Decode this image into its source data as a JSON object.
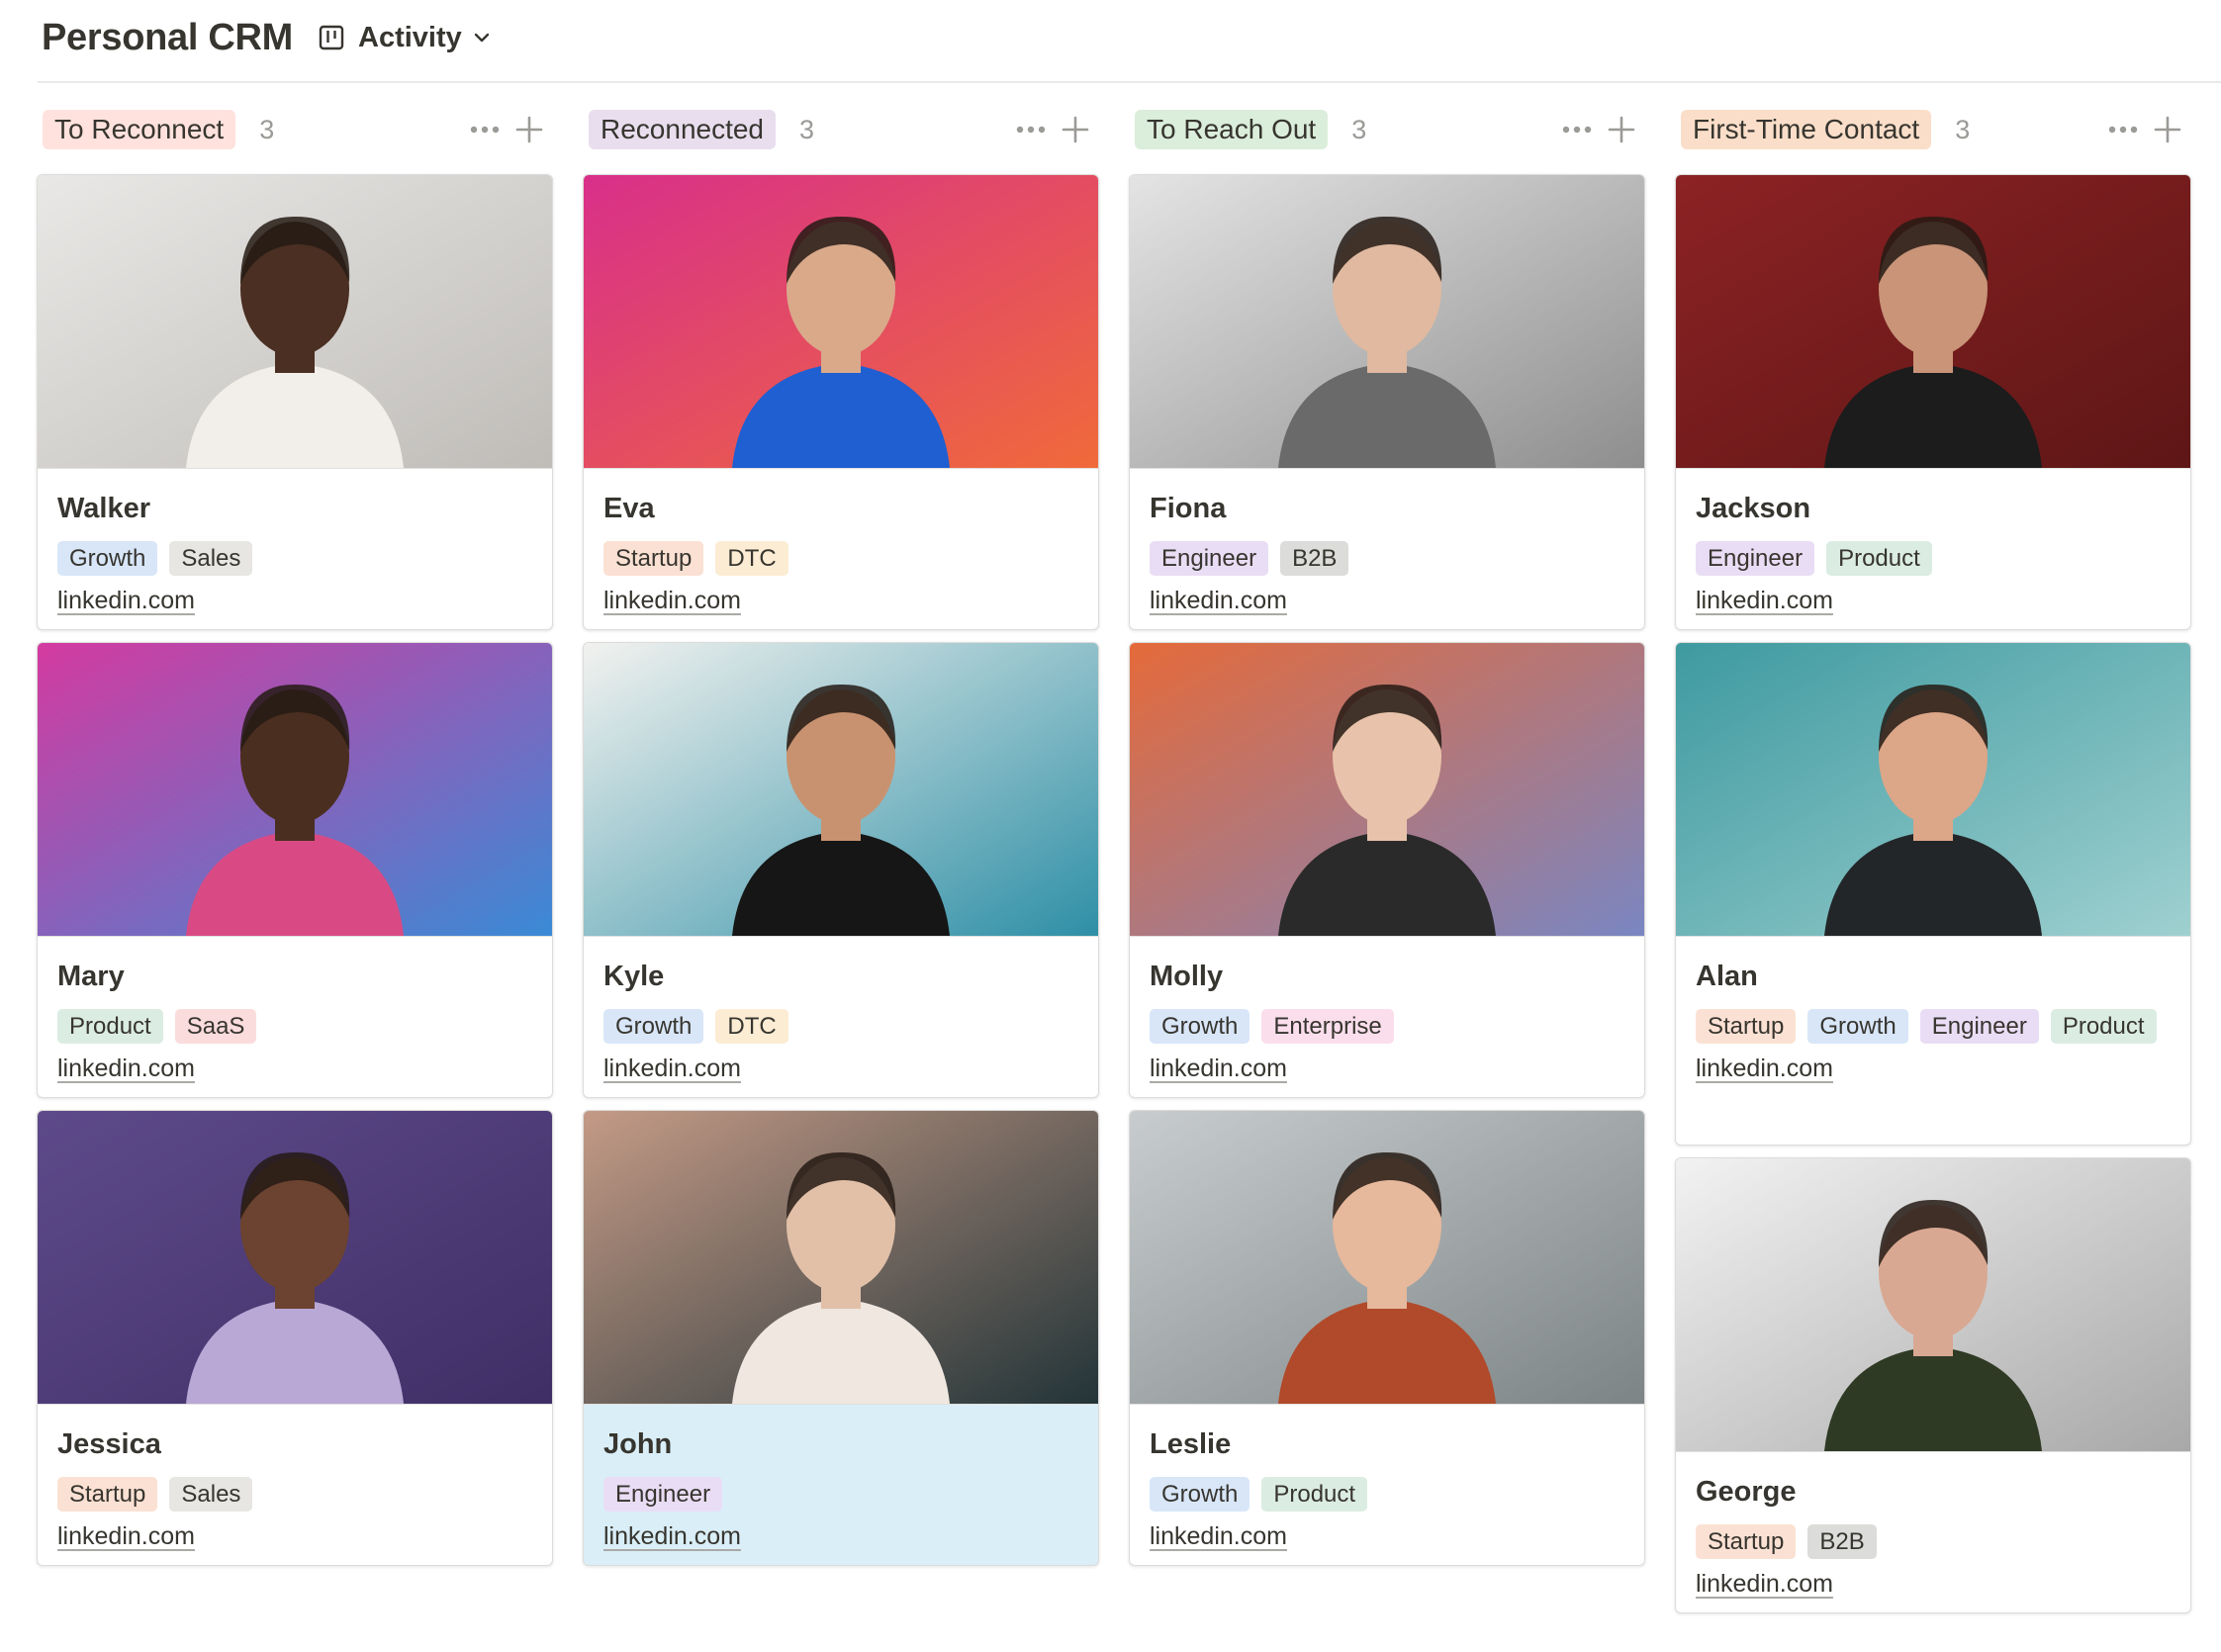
{
  "header": {
    "title": "Personal CRM",
    "view_label": "Activity"
  },
  "colors": {
    "tags": {
      "Growth": "#d8e6f8",
      "Sales": "#e7e6e3",
      "Startup": "#fbe1d3",
      "DTC": "#fbecd3",
      "Engineer": "#e9ddf5",
      "B2B": "#dcdcda",
      "Product": "#dbece3",
      "SaaS": "#fbdcdc",
      "Enterprise": "#fadeec"
    },
    "highlight": "#daeef7"
  },
  "columns": [
    {
      "name": "To Reconnect",
      "count": "3",
      "color": "#ffe2dd",
      "cards": [
        {
          "name": "Walker",
          "tags": [
            "Growth",
            "Sales"
          ],
          "link": "linkedin.com",
          "photo": {
            "bg1": "#e9e8e6",
            "bg2": "#bfbcb8",
            "skin": "#4a2f22",
            "shirt": "#f2efea"
          }
        },
        {
          "name": "Mary",
          "tags": [
            "Product",
            "SaaS"
          ],
          "link": "linkedin.com",
          "photo": {
            "bg1": "#d43aa0",
            "bg2": "#3a8ad6",
            "skin": "#4a2e20",
            "shirt": "#d94a84"
          }
        },
        {
          "name": "Jessica",
          "tags": [
            "Startup",
            "Sales"
          ],
          "link": "linkedin.com",
          "photo": {
            "bg1": "#5e4a8a",
            "bg2": "#3f2e66",
            "skin": "#6b4330",
            "shirt": "#b9a8d6"
          }
        }
      ]
    },
    {
      "name": "Reconnected",
      "count": "3",
      "color": "#e8deee",
      "cards": [
        {
          "name": "Eva",
          "tags": [
            "Startup",
            "DTC"
          ],
          "link": "linkedin.com",
          "photo": {
            "bg1": "#d82f8a",
            "bg2": "#f06a3a",
            "skin": "#d9a98a",
            "shirt": "#1f5fd1"
          }
        },
        {
          "name": "Kyle",
          "tags": [
            "Growth",
            "DTC"
          ],
          "link": "linkedin.com",
          "photo": {
            "bg1": "#f2f2ef",
            "bg2": "#2e8fa6",
            "skin": "#c89270",
            "shirt": "#161616"
          }
        },
        {
          "name": "John",
          "tags": [
            "Engineer"
          ],
          "link": "linkedin.com",
          "highlight": true,
          "photo": {
            "bg1": "#c49a86",
            "bg2": "#233438",
            "skin": "#e2c0a8",
            "shirt": "#efe7e0"
          }
        }
      ]
    },
    {
      "name": "To Reach Out",
      "count": "3",
      "color": "#dbeddb",
      "cards": [
        {
          "name": "Fiona",
          "tags": [
            "Engineer",
            "B2B"
          ],
          "link": "linkedin.com",
          "photo": {
            "bg1": "#e4e4e4",
            "bg2": "#8e8e8e",
            "skin": "#e0b9a0",
            "shirt": "#6a6a6a"
          }
        },
        {
          "name": "Molly",
          "tags": [
            "Growth",
            "Enterprise"
          ],
          "link": "linkedin.com",
          "photo": {
            "bg1": "#e56a3a",
            "bg2": "#7a86c2",
            "skin": "#e8c2aa",
            "shirt": "#2a2a2a"
          }
        },
        {
          "name": "Leslie",
          "tags": [
            "Growth",
            "Product"
          ],
          "link": "linkedin.com",
          "photo": {
            "bg1": "#c8ccce",
            "bg2": "#7c8486",
            "skin": "#e6b89c",
            "shirt": "#b14a2a"
          }
        }
      ]
    },
    {
      "name": "First-Time Contact",
      "count": "3",
      "color": "#fadec9",
      "cards": [
        {
          "name": "Jackson",
          "tags": [
            "Engineer",
            "Product"
          ],
          "link": "linkedin.com",
          "photo": {
            "bg1": "#8c2224",
            "bg2": "#5e1616",
            "skin": "#c99478",
            "shirt": "#1c1c1c"
          }
        },
        {
          "name": "Alan",
          "tags": [
            "Startup",
            "Growth",
            "Engineer",
            "Product"
          ],
          "link": "linkedin.com",
          "photo": {
            "bg1": "#3e9aa0",
            "bg2": "#9fd0d0",
            "skin": "#dca688",
            "shirt": "#232628"
          }
        },
        {
          "name": "George",
          "tags": [
            "Startup",
            "B2B"
          ],
          "link": "linkedin.com",
          "photo": {
            "bg1": "#f2f2f2",
            "bg2": "#a8a8a8",
            "skin": "#d9a892",
            "shirt": "#2f3a24"
          }
        }
      ]
    }
  ]
}
